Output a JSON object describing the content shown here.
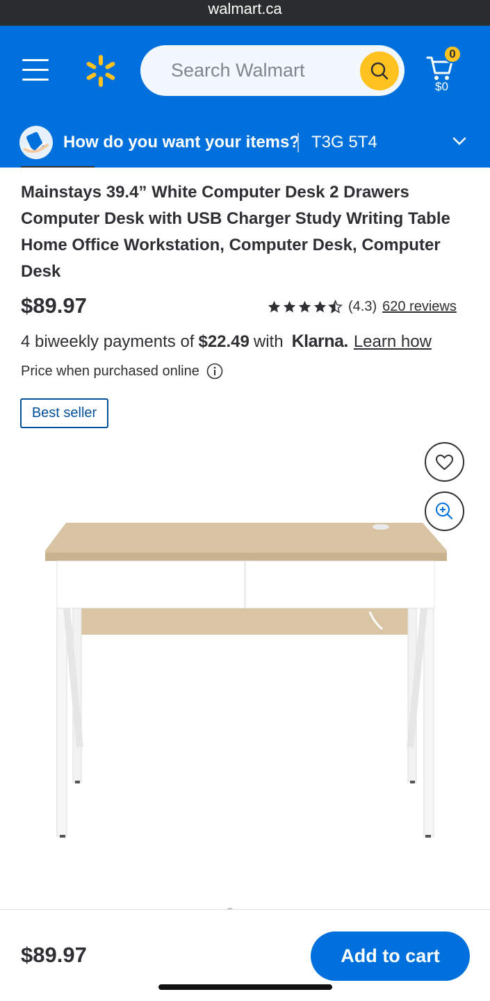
{
  "browser": {
    "url": "walmart.ca"
  },
  "header": {
    "search_placeholder": "Search Walmart",
    "cart_count": "0",
    "cart_total": "$0",
    "icons": [
      "menu-icon",
      "walmart-spark-icon",
      "search-icon",
      "cart-icon"
    ],
    "colors": {
      "header_bg": "#0071dc",
      "accent": "#ffc220"
    }
  },
  "delivery": {
    "question": "How do you want your items?",
    "postal_code": "T3G 5T4"
  },
  "product": {
    "title": "Mainstays 39.4” White Computer Desk 2 Drawers Computer Desk with USB Charger Study Writing Table Home Office Workstation, Computer Desk, Computer Desk",
    "price": "$89.97",
    "rating": 4.3,
    "rating_text": "(4.3)",
    "reviews_text": "620 reviews",
    "klarna": {
      "prefix": "4 biweekly payments of",
      "amount": "$22.49",
      "with": "with",
      "logo": "Klarna.",
      "link": "Learn how"
    },
    "price_note": "Price when purchased online",
    "badge": "Best seller",
    "image_desc_icons": [
      "heart-icon",
      "zoom-in-icon"
    ]
  },
  "footer": {
    "price": "$89.97",
    "add_to_cart": "Add to cart"
  }
}
